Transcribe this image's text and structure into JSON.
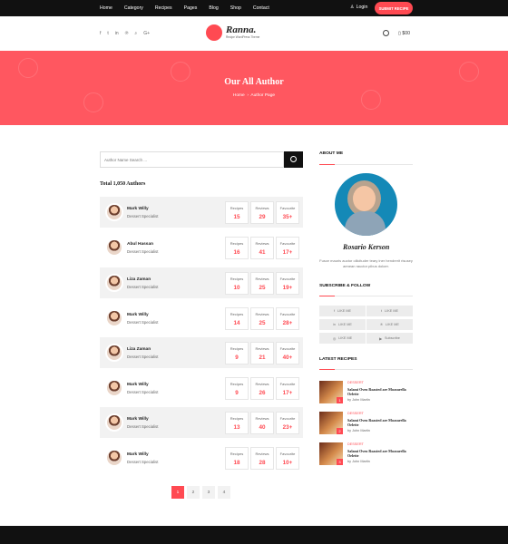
{
  "topbar": {
    "nav": [
      "Home",
      "Category",
      "Recipes",
      "Pages",
      "Blog",
      "Shop",
      "Contact"
    ],
    "login": "Login",
    "submit": "SUBMIT RECIPE"
  },
  "header": {
    "social": [
      "f",
      "t",
      "in",
      "℗",
      "⌕",
      "G+"
    ],
    "brand": "Ranna.",
    "tagline": "Recipe WordPress Theme",
    "cart": "$00"
  },
  "banner": {
    "title": "Our All Author",
    "breadcrumb_home": "Home",
    "breadcrumb_current": "Author Page"
  },
  "search": {
    "placeholder": "Author Name Search ..."
  },
  "total": "Total 1,050 Authors",
  "stat_labels": [
    "Recipes",
    "Reviews",
    "Favourite"
  ],
  "authors": [
    {
      "name": "Mark Willy",
      "role": "Dessert Specialist",
      "recipes": "15",
      "reviews": "29",
      "favourite": "35+"
    },
    {
      "name": "Abul Hassan",
      "role": "Dessert Specialist",
      "recipes": "16",
      "reviews": "41",
      "favourite": "17+"
    },
    {
      "name": "Liza Zaman",
      "role": "Dessert Specialist",
      "recipes": "10",
      "reviews": "25",
      "favourite": "19+"
    },
    {
      "name": "Mark Willy",
      "role": "Dessert Specialist",
      "recipes": "14",
      "reviews": "25",
      "favourite": "28+"
    },
    {
      "name": "Liza Zaman",
      "role": "Dessert Specialist",
      "recipes": "9",
      "reviews": "21",
      "favourite": "40+"
    },
    {
      "name": "Mark Willy",
      "role": "Dessert Specialist",
      "recipes": "9",
      "reviews": "26",
      "favourite": "17+"
    },
    {
      "name": "Mark Willy",
      "role": "Dessert Specialist",
      "recipes": "13",
      "reviews": "40",
      "favourite": "23+"
    },
    {
      "name": "Mark Willy",
      "role": "Dessert Specialist",
      "recipes": "18",
      "reviews": "28",
      "favourite": "10+"
    }
  ],
  "pagination": [
    "1",
    "2",
    "3",
    "4"
  ],
  "sidebar": {
    "about_title": "ABOUT ME",
    "signature": "Rosario Kerson",
    "about_text": "Fusce mauris auctor ollicituder teary iner hendrerit risusey aenean rauctor pibus doloer.",
    "follow_title": "SUBSCRIBE & FOLLOW",
    "social_items": [
      {
        "icon": "f",
        "label": "LIKE ME"
      },
      {
        "icon": "t",
        "label": "LIKE ME"
      },
      {
        "icon": "in",
        "label": "LIKE ME"
      },
      {
        "icon": "℗",
        "label": "LIKE ME"
      },
      {
        "icon": "◎",
        "label": "LIKE ME"
      },
      {
        "icon": "▶",
        "label": "Subscribe"
      }
    ],
    "latest_title": "LATEST RECIPES",
    "recipes": [
      {
        "number": "1",
        "category": "DESSERT",
        "title": "Salami Oven Roasted are Mozzarella Oelette",
        "author": "by John Martin"
      },
      {
        "number": "2",
        "category": "DESSERT",
        "title": "Salami Oven Roasted are Mozzarella Oelette",
        "author": "by John Martin"
      },
      {
        "number": "3",
        "category": "DESSERT",
        "title": "Salami Oven Roasted are Mozzarella Oelette",
        "author": "by John Martin"
      }
    ]
  }
}
